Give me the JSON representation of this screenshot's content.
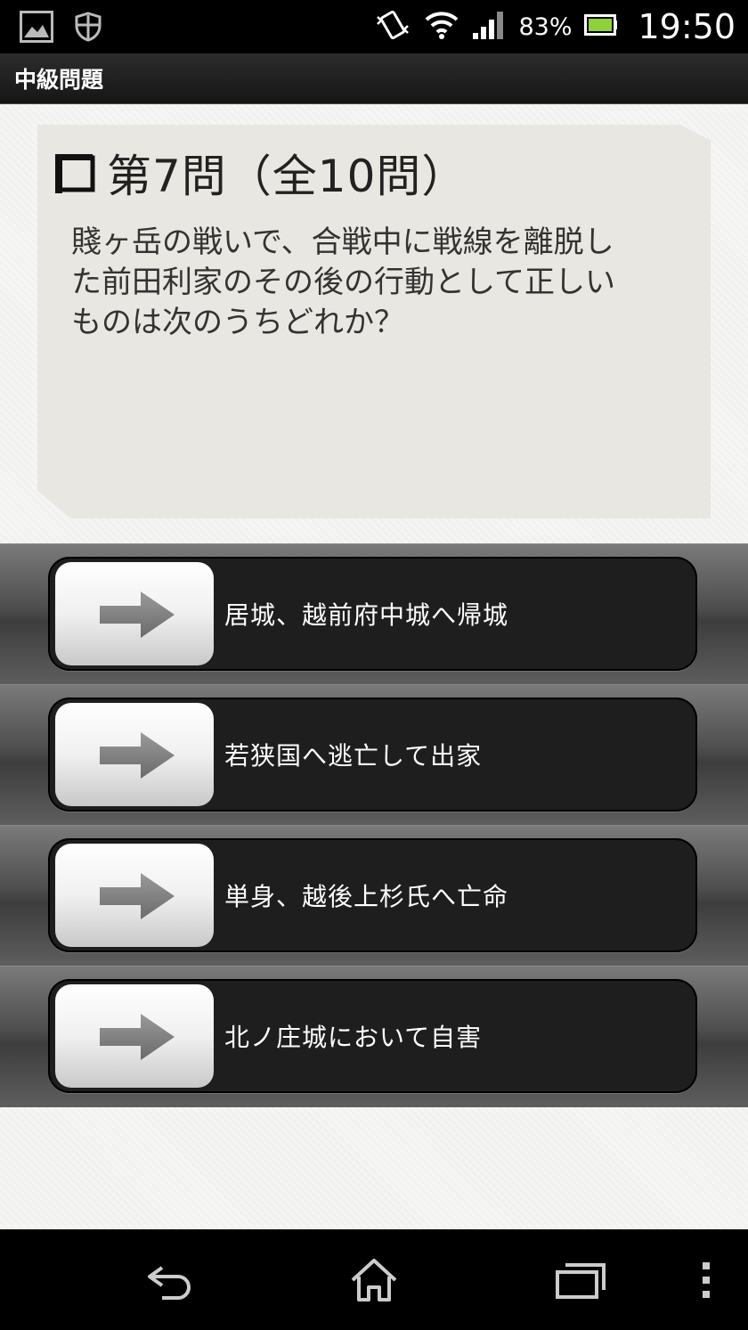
{
  "status_bar": {
    "battery_percent": "83%",
    "clock": "19:50",
    "icons": [
      "gallery-notification-icon",
      "shield-notification-icon",
      "vibrate-icon",
      "wifi-icon",
      "signal-icon",
      "battery-icon"
    ]
  },
  "action_bar": {
    "title": "中級問題"
  },
  "question": {
    "heading": "第7問（全10問）",
    "text_lines": [
      "賤ヶ岳の戦いで、合戦中に戦線を離脱し",
      "た前田利家のその後の行動として正しい",
      "ものは次のうちどれか？"
    ]
  },
  "answers": [
    {
      "label": "居城、越前府中城へ帰城"
    },
    {
      "label": "若狭国へ逃亡して出家"
    },
    {
      "label": "単身、越後上杉氏へ亡命"
    },
    {
      "label": "北ノ庄城において自害"
    }
  ],
  "nav_bar": {
    "icons": [
      "back-icon",
      "home-icon",
      "recent-apps-icon",
      "menu-icon"
    ]
  },
  "colors": {
    "answer_button_bg": "#1e1e1e",
    "card_bg": "#e9e7e1",
    "bar_bg": "#000000"
  }
}
